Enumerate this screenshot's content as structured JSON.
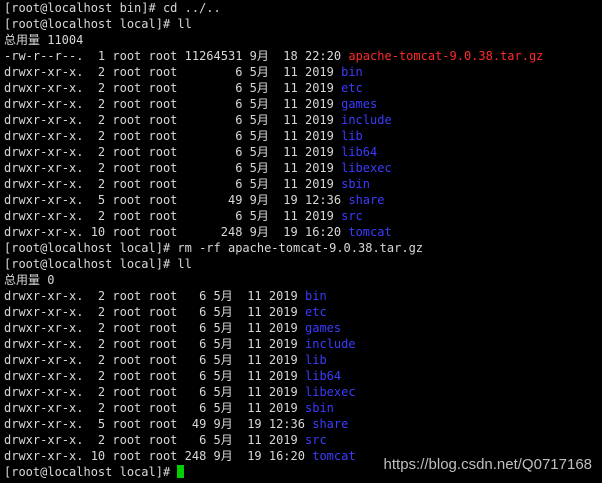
{
  "terminal": {
    "lines": [
      {
        "type": "plain",
        "text": "[root@localhost bin]# cd ../.."
      },
      {
        "type": "plain",
        "text": "[root@localhost local]# ll"
      },
      {
        "type": "plain",
        "text": "总用量 11004"
      },
      {
        "type": "entry",
        "meta": "-rw-r--r--.  1 root root 11264531 9月  18 22:20 ",
        "name": "apache-tomcat-9.0.38.tar.gz",
        "color": "#ff2a2a"
      },
      {
        "type": "entry",
        "meta": "drwxr-xr-x.  2 root root        6 5月  11 2019 ",
        "name": "bin",
        "color": "#3b3bff"
      },
      {
        "type": "entry",
        "meta": "drwxr-xr-x.  2 root root        6 5月  11 2019 ",
        "name": "etc",
        "color": "#3b3bff"
      },
      {
        "type": "entry",
        "meta": "drwxr-xr-x.  2 root root        6 5月  11 2019 ",
        "name": "games",
        "color": "#3b3bff"
      },
      {
        "type": "entry",
        "meta": "drwxr-xr-x.  2 root root        6 5月  11 2019 ",
        "name": "include",
        "color": "#3b3bff"
      },
      {
        "type": "entry",
        "meta": "drwxr-xr-x.  2 root root        6 5月  11 2019 ",
        "name": "lib",
        "color": "#3b3bff"
      },
      {
        "type": "entry",
        "meta": "drwxr-xr-x.  2 root root        6 5月  11 2019 ",
        "name": "lib64",
        "color": "#3b3bff"
      },
      {
        "type": "entry",
        "meta": "drwxr-xr-x.  2 root root        6 5月  11 2019 ",
        "name": "libexec",
        "color": "#3b3bff"
      },
      {
        "type": "entry",
        "meta": "drwxr-xr-x.  2 root root        6 5月  11 2019 ",
        "name": "sbin",
        "color": "#3b3bff"
      },
      {
        "type": "entry",
        "meta": "drwxr-xr-x.  5 root root       49 9月  19 12:36 ",
        "name": "share",
        "color": "#3b3bff"
      },
      {
        "type": "entry",
        "meta": "drwxr-xr-x.  2 root root        6 5月  11 2019 ",
        "name": "src",
        "color": "#3b3bff"
      },
      {
        "type": "entry",
        "meta": "drwxr-xr-x. 10 root root      248 9月  19 16:20 ",
        "name": "tomcat",
        "color": "#3b3bff"
      },
      {
        "type": "plain",
        "text": "[root@localhost local]# rm -rf apache-tomcat-9.0.38.tar.gz"
      },
      {
        "type": "plain",
        "text": "[root@localhost local]# ll"
      },
      {
        "type": "plain",
        "text": "总用量 0"
      },
      {
        "type": "entry",
        "meta": "drwxr-xr-x.  2 root root   6 5月  11 2019 ",
        "name": "bin",
        "color": "#3b3bff"
      },
      {
        "type": "entry",
        "meta": "drwxr-xr-x.  2 root root   6 5月  11 2019 ",
        "name": "etc",
        "color": "#3b3bff"
      },
      {
        "type": "entry",
        "meta": "drwxr-xr-x.  2 root root   6 5月  11 2019 ",
        "name": "games",
        "color": "#3b3bff"
      },
      {
        "type": "entry",
        "meta": "drwxr-xr-x.  2 root root   6 5月  11 2019 ",
        "name": "include",
        "color": "#3b3bff"
      },
      {
        "type": "entry",
        "meta": "drwxr-xr-x.  2 root root   6 5月  11 2019 ",
        "name": "lib",
        "color": "#3b3bff"
      },
      {
        "type": "entry",
        "meta": "drwxr-xr-x.  2 root root   6 5月  11 2019 ",
        "name": "lib64",
        "color": "#3b3bff"
      },
      {
        "type": "entry",
        "meta": "drwxr-xr-x.  2 root root   6 5月  11 2019 ",
        "name": "libexec",
        "color": "#3b3bff"
      },
      {
        "type": "entry",
        "meta": "drwxr-xr-x.  2 root root   6 5月  11 2019 ",
        "name": "sbin",
        "color": "#3b3bff"
      },
      {
        "type": "entry",
        "meta": "drwxr-xr-x.  5 root root  49 9月  19 12:36 ",
        "name": "share",
        "color": "#3b3bff"
      },
      {
        "type": "entry",
        "meta": "drwxr-xr-x.  2 root root   6 5月  11 2019 ",
        "name": "src",
        "color": "#3b3bff"
      },
      {
        "type": "entry",
        "meta": "drwxr-xr-x. 10 root root 248 9月  19 16:20 ",
        "name": "tomcat",
        "color": "#3b3bff"
      }
    ],
    "prompt": "[root@localhost local]# ",
    "cursor_color": "#00d000"
  },
  "watermark": {
    "text": "https://blog.csdn.net/Q0717168"
  }
}
